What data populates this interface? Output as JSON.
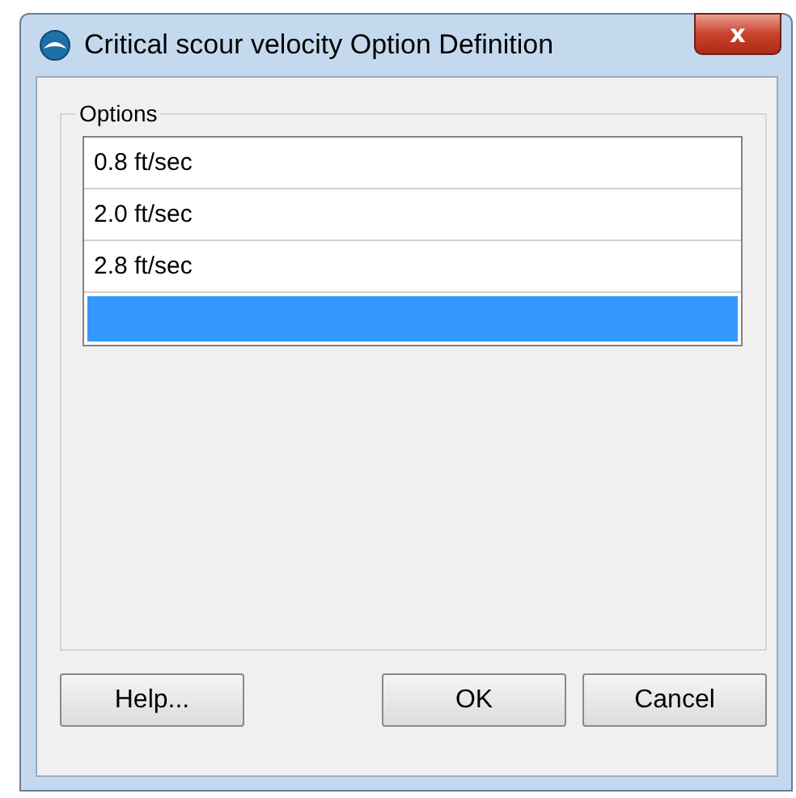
{
  "window": {
    "title": "Critical scour velocity Option Definition",
    "close_label": "x"
  },
  "options": {
    "label": "Options",
    "rows": [
      {
        "text": "0.8 ft/sec",
        "selected": false
      },
      {
        "text": "2.0 ft/sec",
        "selected": false
      },
      {
        "text": "2.8 ft/sec",
        "selected": false
      },
      {
        "selected": true
      }
    ]
  },
  "buttons": [
    "Help...",
    "OK",
    "Cancel"
  ]
}
